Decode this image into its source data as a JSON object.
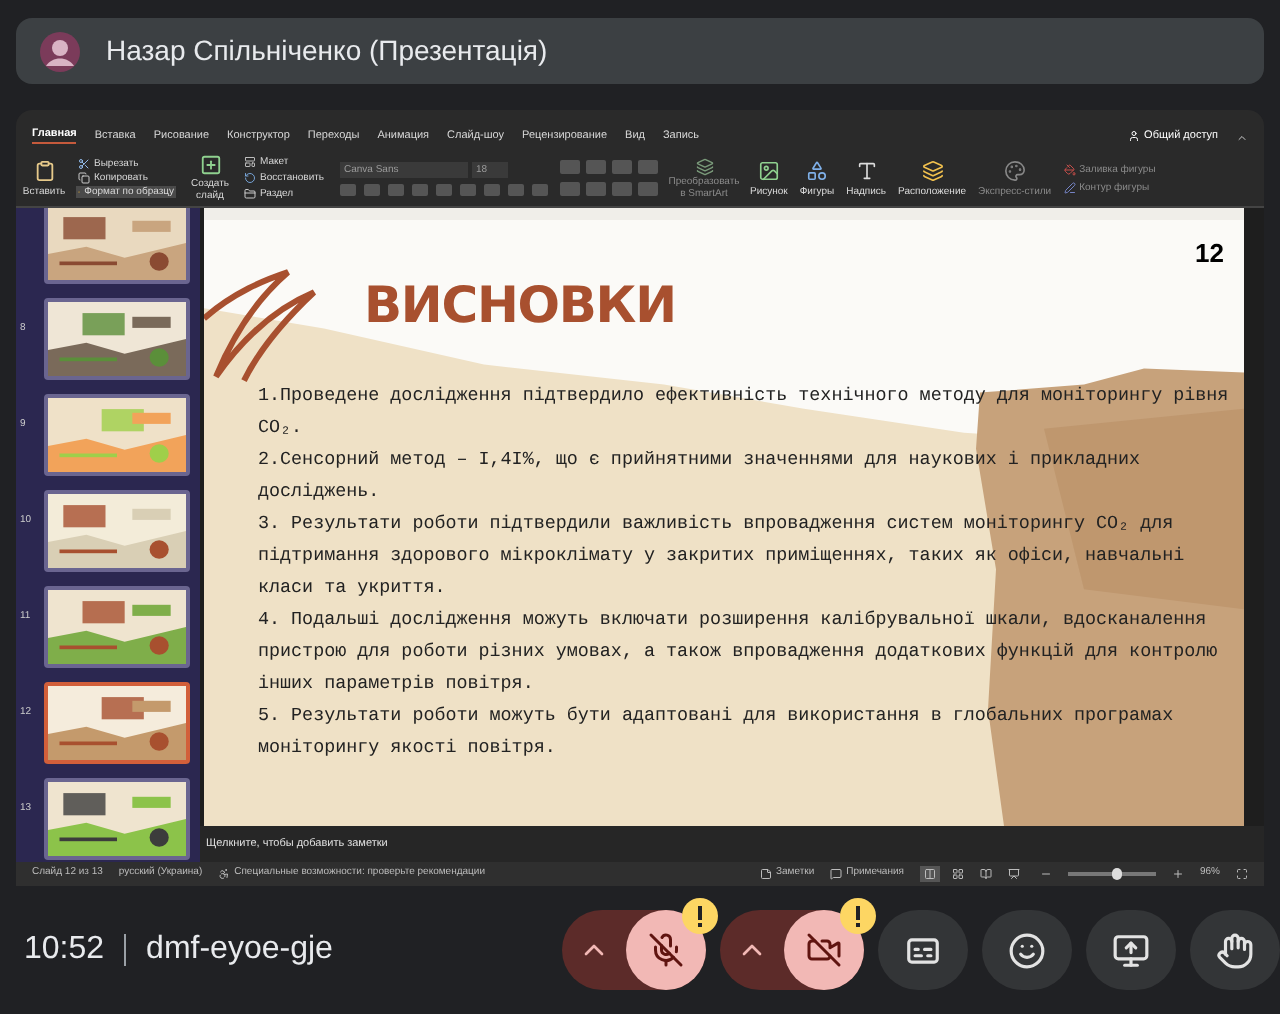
{
  "presenter": {
    "name": "Назар Спільніченко (Презентація)"
  },
  "ribbon_tabs": [
    {
      "label": "Главная",
      "selected": true
    },
    {
      "label": "Вставка",
      "selected": false
    },
    {
      "label": "Рисование",
      "selected": false
    },
    {
      "label": "Конструктор",
      "selected": false
    },
    {
      "label": "Переходы",
      "selected": false
    },
    {
      "label": "Анимация",
      "selected": false
    },
    {
      "label": "Слайд-шоу",
      "selected": false
    },
    {
      "label": "Рецензирование",
      "selected": false
    },
    {
      "label": "Вид",
      "selected": false
    },
    {
      "label": "Запись",
      "selected": false
    }
  ],
  "share_button": "Общий доступ",
  "ribbon": {
    "paste": "Вставить",
    "clipboard_items": [
      {
        "kind": "cut",
        "label": "Вырезать",
        "selected": false
      },
      {
        "kind": "copy",
        "label": "Копировать",
        "selected": false
      },
      {
        "kind": "format",
        "label": "Формат по образцу",
        "selected": true
      }
    ],
    "new_slide": "Создать слайд",
    "slide_items": [
      {
        "kind": "layout",
        "label": "Макет"
      },
      {
        "kind": "reset",
        "label": "Восстановить"
      },
      {
        "kind": "section",
        "label": "Раздел"
      }
    ],
    "font": {
      "name": "Canva Sans",
      "size": "18"
    },
    "smartart": {
      "label": "Преобразовать в SmartArt",
      "disabled": true
    },
    "insert_tools": [
      {
        "kind": "picture",
        "label": "Рисунок",
        "disabled": false
      },
      {
        "kind": "shapes",
        "label": "Фигуры",
        "disabled": false
      },
      {
        "kind": "textbox",
        "label": "Надпись",
        "disabled": false
      },
      {
        "kind": "arrange",
        "label": "Расположение",
        "disabled": false
      },
      {
        "kind": "styles",
        "label": "Экспресс-стили",
        "disabled": true
      }
    ],
    "shape_format": [
      {
        "kind": "fill",
        "label": "Заливка фигуры",
        "disabled": true
      },
      {
        "kind": "outline",
        "label": "Контур фигуры",
        "disabled": true
      }
    ]
  },
  "thumbnails": [
    {
      "selected": false
    },
    {
      "number": "8",
      "selected": false
    },
    {
      "number": "9",
      "selected": false
    },
    {
      "number": "10",
      "selected": false
    },
    {
      "number": "11",
      "selected": false
    },
    {
      "number": "12",
      "selected": true
    },
    {
      "number": "13",
      "selected": false
    }
  ],
  "slide": {
    "number": "12",
    "title": "ВИСНОВКИ",
    "points": [
      "1.Проведене дослідження підтвердило ефективність технічного методу для моніторингу рівня CO₂.",
      "2.Сенсорний метод – I,4I%, що є прийнятними значеннями для наукових і прикладних досліджень.",
      "3. Результати роботи підтвердили важливість впровадження систем моніторингу CO₂ для підтримання здорового мікроклімату у закритих приміщеннях, таких як офіси, навчальні класи та укриття.",
      "4. Подальші дослідження можуть включати розширення калібрувальної шкали, вдосканалення пристрою для роботи різних умовах, а також впровадження додаткових функцій для контролю інших параметрів повітря.",
      "5. Результати роботи можуть бути адаптовані для використання в глобальних програмах моніторингу якості повітря."
    ]
  },
  "notes_hint": "Щелкните, чтобы добавить заметки",
  "status_bar": {
    "slide": "Слайд 12 из 13",
    "language": "русский (Украина)",
    "accessibility": "Специальные возможности: проверьте рекомендации",
    "notes": "Заметки",
    "comments": "Примечания",
    "views": [
      {
        "kind": "normal",
        "selected": true
      },
      {
        "kind": "sorter",
        "selected": false
      },
      {
        "kind": "reading",
        "selected": false
      },
      {
        "kind": "slideshow",
        "selected": false
      }
    ],
    "zoom": {
      "level": 0.55,
      "reading": "96%"
    }
  },
  "meeting": {
    "time": "10:52",
    "code": "dmf-eyoe-gje"
  },
  "controls": [
    {
      "kind": "mic",
      "on": false,
      "warning": true
    },
    {
      "kind": "camera",
      "on": false,
      "warning": true
    },
    {
      "kind": "captions"
    },
    {
      "kind": "reactions"
    },
    {
      "kind": "present"
    },
    {
      "kind": "hand"
    }
  ]
}
